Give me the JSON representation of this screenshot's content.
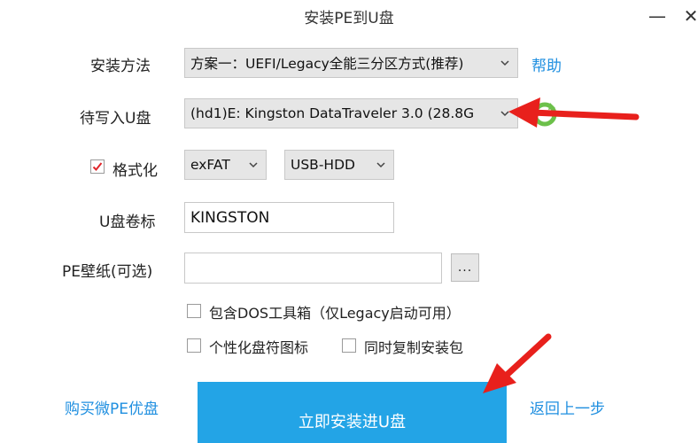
{
  "window": {
    "title": "安装PE到U盘",
    "minimize_glyph": "—",
    "close_glyph": "✕"
  },
  "install_method": {
    "label": "安装方法",
    "value": "方案一：UEFI/Legacy全能三分区方式(推荐)",
    "help_link": "帮助"
  },
  "target_drive": {
    "label": "待写入U盘",
    "value": "(hd1)E: Kingston DataTraveler 3.0 (28.8G"
  },
  "format": {
    "label": "格式化",
    "checked": true,
    "filesystem": "exFAT",
    "mode": "USB-HDD"
  },
  "volume_label": {
    "label": "U盘卷标",
    "value": "KINGSTON"
  },
  "wallpaper": {
    "label": "PE壁纸(可选)",
    "value": "",
    "browse_label": "..."
  },
  "options": {
    "dos_toolbox": "包含DOS工具箱（仅Legacy启动可用）",
    "custom_icon": "个性化盘符图标",
    "copy_installer": "同时复制安装包"
  },
  "footer": {
    "buy_link": "购买微PE优盘",
    "install_button": "立即安装进U盘",
    "back_link": "返回上一步"
  },
  "annotations": {
    "arrow_color": "#e8201c",
    "accent": "#23a4e6",
    "link_color": "#1f8fe0",
    "refresh_icon_color": "#6cc04a"
  }
}
